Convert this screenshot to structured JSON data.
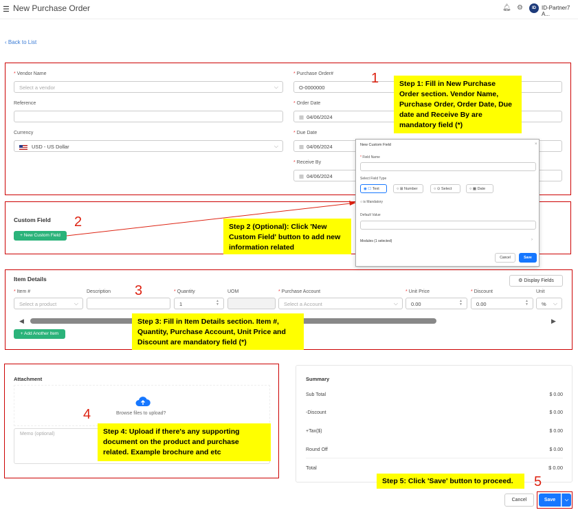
{
  "header": {
    "title": "New Purchase Order",
    "user": "ID-Partner7 A...",
    "avatar": "ID"
  },
  "nav": {
    "back": "Back to List"
  },
  "form": {
    "vendor_label": "Vendor Name",
    "vendor_placeholder": "Select a vendor",
    "reference_label": "Reference",
    "currency_label": "Currency",
    "currency_value": "USD - US Dollar",
    "po_label": "Purchase Order#",
    "po_value": "O-0000000",
    "order_date_label": "Order Date",
    "order_date": "04/06/2024",
    "due_date_label": "Due Date",
    "due_date": "04/06/2024",
    "receive_label": "Receive By",
    "receive_date": "04/06/2024"
  },
  "custom_field": {
    "title": "Custom Field",
    "button": "+ New Custom Field"
  },
  "dialog": {
    "title": "New Custom Field",
    "field_name": "Field Name",
    "type_label": "Select Field Type",
    "types": [
      "Text",
      "Number",
      "Select",
      "Date"
    ],
    "mandatory": "is Mandatory",
    "default_label": "Default Value",
    "modules": "Modules (1 selected)",
    "cancel": "Cancel",
    "save": "Save"
  },
  "items": {
    "title": "Item Details",
    "display_fields": "Display Fields",
    "headers": {
      "item": "Item #",
      "description": "Description",
      "quantity": "Quantity",
      "uom": "UOM",
      "account": "Purchase Account",
      "price": "Unit Price",
      "discount": "Discount",
      "unit": "Unit"
    },
    "item_placeholder": "Select a product",
    "quantity": "1",
    "account_placeholder": "Select a Account",
    "price": "0.00",
    "discount": "0.00",
    "unit": "%",
    "add": "+ Add Another Item"
  },
  "attachment": {
    "title": "Attachment",
    "browse": "Browse files to upload?",
    "memo": "Memo (optional)"
  },
  "summary": {
    "title": "Summary",
    "rows": [
      {
        "label": "Sub Total",
        "value": "$ 0.00"
      },
      {
        "label": "-Discount",
        "value": "$ 0.00"
      },
      {
        "label": "+Tax($)",
        "value": "$ 0.00"
      },
      {
        "label": "Round Off",
        "value": "$ 0.00"
      }
    ],
    "total_label": "Total",
    "total_value": "$ 0.00"
  },
  "footer": {
    "cancel": "Cancel",
    "save": "Save"
  },
  "annotations": {
    "n1": "1",
    "n2": "2",
    "n3": "3",
    "n4": "4",
    "n5": "5",
    "step1": "Step 1: Fill in New Purchase Order section. Vendor Name, Purchase Order, Order Date, Due date and Receive By are mandatory field (*)",
    "step2": "Step 2 (Optional): Click 'New Custom Field' button to add new information related",
    "step3": "Step 3: Fill in Item Details section. Item #, Quantity, Purchase Account, Unit Price and Discount are mandatory field (*)",
    "step4": "Step 4: Upload if there's any supporting document on the product and purchase related. Example brochure and etc",
    "step5": "Step 5: Click 'Save' button to proceed."
  }
}
